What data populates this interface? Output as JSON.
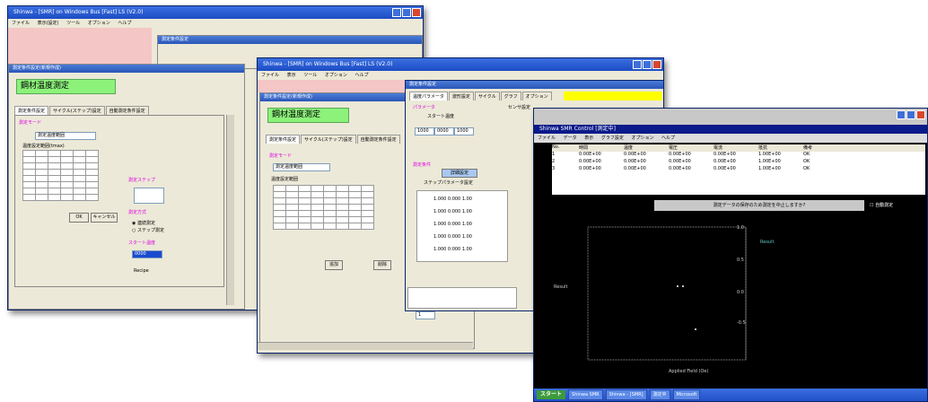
{
  "window1": {
    "title": "Shinwa - [SMR] on Windows Bus [Fast] LS (V2.0)",
    "menu": [
      "ファイル",
      "表示(設定)",
      "ツール",
      "オプション",
      "ヘルプ"
    ],
    "dialog_title": "測定条件設定",
    "sub_title": "測定条件設定(新規作成)",
    "green_label": "鋼材温度測定",
    "tabs": [
      "測定条件設定",
      "サイクル(ステップ)設定",
      "自動測定条件設定"
    ],
    "mode_label": "測定モード",
    "combo_value": "測定温度範囲",
    "table_label": "温度設定範囲(tmax)",
    "right_label1": "測定ステップ",
    "right_label2": "測定方式",
    "radio1": "連続測定",
    "radio2": "ステップ測定",
    "right_label3": "スタート温度",
    "field_value": "0000",
    "btn_ok": "OK",
    "btn_cancel": "キャンセル",
    "small_label": "Recipe"
  },
  "window2": {
    "title": "Shinwa - [SMR] on Windows Bus [Fast] LS (V2.0)",
    "menu": [
      "ファイル",
      "表示",
      "ツール",
      "オプション",
      "ヘルプ"
    ],
    "sub_title": "測定条件設定(新規作成)",
    "green_label": "鋼材温度測定",
    "tabs": [
      "測定条件設定",
      "サイクル(ステップ)設定",
      "自動測定条件設定"
    ],
    "mode_label": "測定モード",
    "combo_value": "測定温度範囲",
    "table_label": "温度設定範囲",
    "btn_add": "追加",
    "btn_del": "削除",
    "inner_dialog_title": "測定条件設定",
    "inner_tabs": [
      "温度パラメータ",
      "波形設定",
      "サイクル",
      "グラフ",
      "オプション"
    ],
    "inner_labels": [
      "パラメータ",
      "スタート温度",
      "センサ設定"
    ],
    "inner_field_values": [
      "1000",
      "0000",
      "1000"
    ],
    "inner_section": "測定条件",
    "inner_button": "詳細設定",
    "list_header": "ステップパラメータ設定",
    "rows": [
      "1.000",
      "0.000",
      "1.00"
    ],
    "bottom_field": "1"
  },
  "window3": {
    "title": "Shinwa SMR Control [測定中]",
    "menu": [
      "ファイル",
      "データ",
      "表示",
      "グラフ設定",
      "オプション",
      "ヘルプ"
    ],
    "table_headers": [
      "No.",
      "時間",
      "温度",
      "電圧",
      "電流",
      "抵抗",
      "備考"
    ],
    "table_rows": [
      [
        "1",
        "0.00E+00",
        "0.00E+00",
        "0.00E+00",
        "0.00E+00",
        "1.00E+00",
        "OK"
      ],
      [
        "2",
        "0.00E+00",
        "0.00E+00",
        "0.00E+00",
        "0.00E+00",
        "1.00E+00",
        "OK"
      ],
      [
        "3",
        "0.00E+00",
        "0.00E+00",
        "0.00E+00",
        "0.00E+00",
        "1.00E+00",
        "OK"
      ]
    ],
    "status_text": "測定データの保存のため測定を中止しますか?",
    "checkbox_label": "自動測定",
    "chart_ylabel": "Result",
    "chart_xlabel": "Applied Field (Oe)",
    "y_ticks": [
      "1.0",
      "0.5",
      "0.0",
      "-0.5"
    ],
    "legend": "Result",
    "taskbar": [
      "スタート",
      "Shinwa SMR",
      "Shinwa - [SMR]",
      "測定中",
      "Microsoft"
    ]
  }
}
